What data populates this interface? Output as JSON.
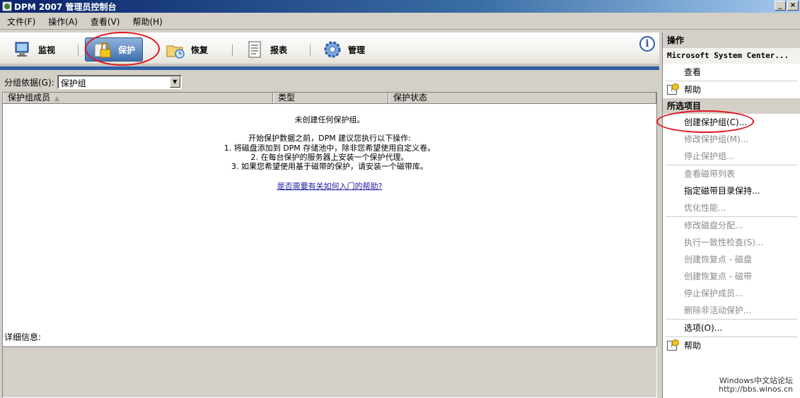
{
  "window": {
    "title": "DPM 2007 管理员控制台",
    "minimize": "_",
    "close": "×"
  },
  "menu": {
    "items": [
      "文件(F)",
      "操作(A)",
      "查看(V)",
      "帮助(H)"
    ]
  },
  "nav": {
    "tabs": [
      {
        "label": "监视",
        "icon": "monitor-icon"
      },
      {
        "label": "保护",
        "icon": "protection-lock-icon"
      },
      {
        "label": "恢复",
        "icon": "recovery-folder-icon"
      },
      {
        "label": "报表",
        "icon": "report-icon"
      },
      {
        "label": "管理",
        "icon": "management-gear-icon"
      }
    ],
    "active": "保护",
    "info_symbol": "i"
  },
  "groupby": {
    "label": "分组依据(G):",
    "value": "保护组"
  },
  "table": {
    "columns": [
      "保护组成员",
      "类型",
      "保护状态"
    ],
    "sort_indicator": "▲"
  },
  "empty": {
    "title": "未创建任何保护组。",
    "lines": [
      "开始保护数据之前，DPM 建议您执行以下操作:",
      "1. 将磁盘添加到 DPM 存储池中，除非您希望使用自定义卷。",
      "2. 在每台保护的服务器上安装一个保护代理。",
      "3. 如果您希望使用基于磁带的保护，请安装一个磁带库。"
    ],
    "help_link": "是否需要有关如何入门的帮助?"
  },
  "details": {
    "label": "详细信息:"
  },
  "actions": {
    "header": "操作",
    "snapin": "Microsoft System Center...",
    "top_items": [
      {
        "label": "查看",
        "icon": "",
        "enabled": true
      },
      {
        "label": "帮助",
        "icon": "help-icon",
        "enabled": true
      }
    ],
    "selected_header": "所选项目",
    "selected_items": [
      {
        "label": "创建保护组(C)...",
        "enabled": true
      },
      {
        "label": "修改保护组(M)...",
        "enabled": false
      },
      {
        "label": "停止保护组...",
        "enabled": false
      },
      {
        "label": "查看磁带列表",
        "enabled": false
      },
      {
        "label": "指定磁带目录保持...",
        "enabled": true
      },
      {
        "label": "优化性能...",
        "enabled": false
      },
      {
        "label": "修改磁盘分配...",
        "enabled": false
      },
      {
        "label": "执行一致性检查(S)...",
        "enabled": false
      },
      {
        "label": "创建恢复点 - 磁盘",
        "enabled": false
      },
      {
        "label": "创建恢复点 - 磁带",
        "enabled": false
      },
      {
        "label": "停止保护成员...",
        "enabled": false
      },
      {
        "label": "删除非活动保护...",
        "enabled": false
      },
      {
        "label": "选项(O)...",
        "enabled": true
      },
      {
        "label": "帮助",
        "enabled": true
      }
    ]
  },
  "watermark": {
    "line1": "Windows中文站论坛",
    "line2": "http://bbs.winos.cn"
  },
  "colors": {
    "accent_blue": "#2e5fa6",
    "annotation_red": "#e0141e",
    "disabled_text": "#8a8a8a"
  }
}
